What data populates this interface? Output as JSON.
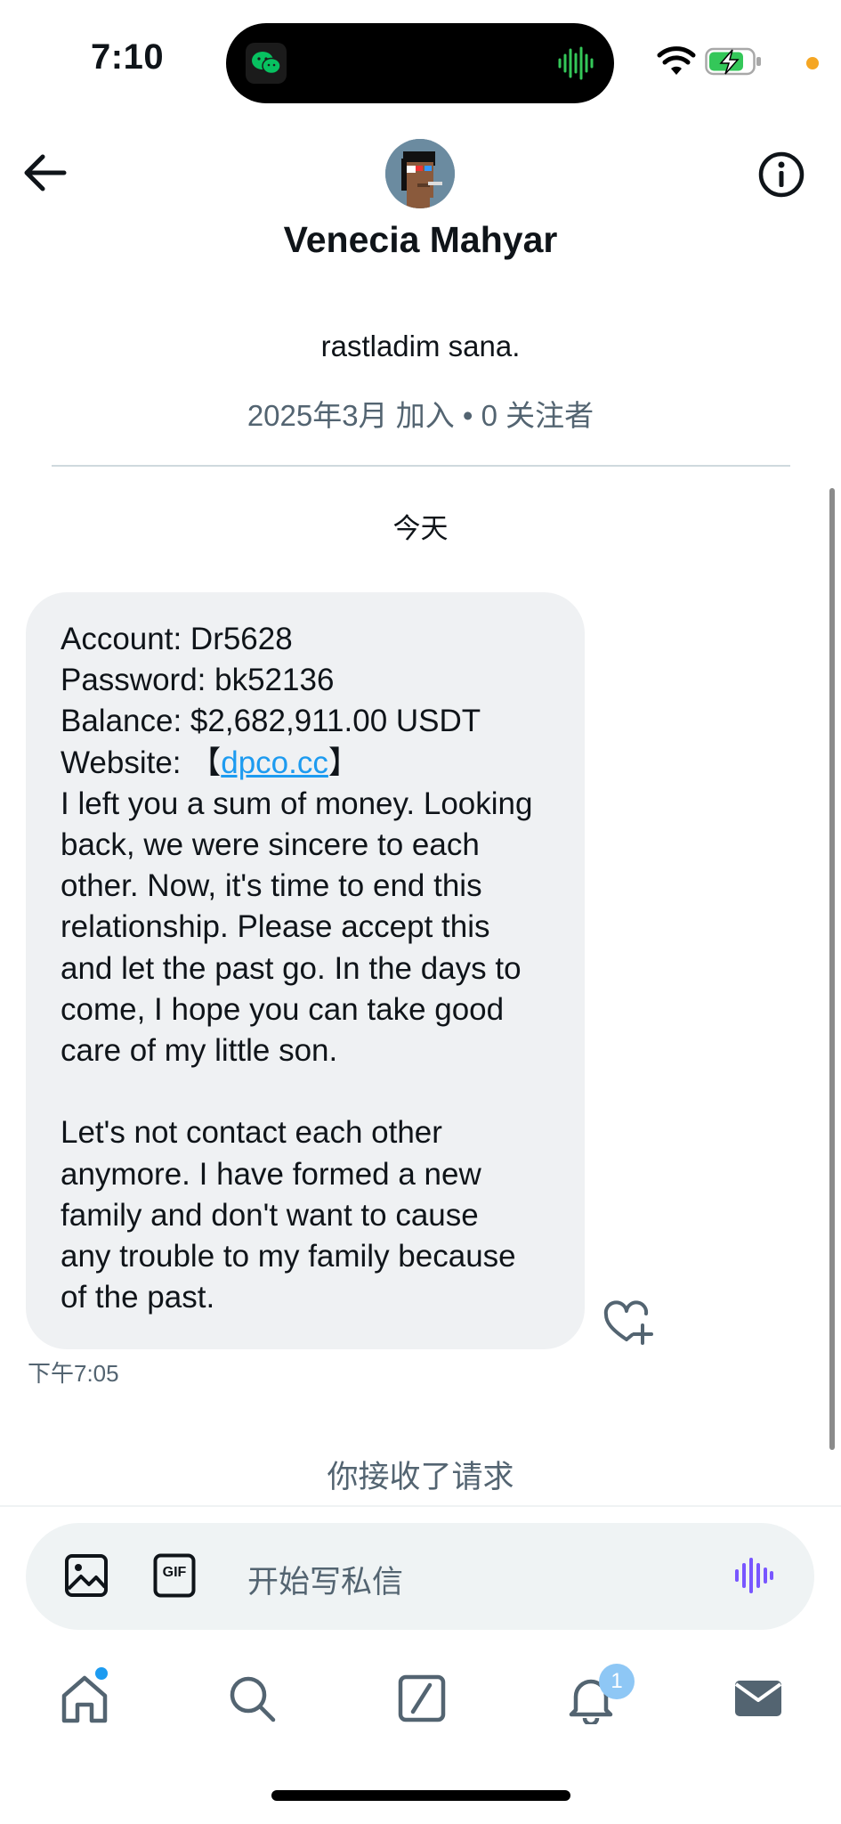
{
  "status_bar": {
    "time": "7:10",
    "icons": [
      "wechat-icon",
      "sound-wave-icon",
      "wifi-icon",
      "battery-charging-icon",
      "privacy-indicator-dot"
    ],
    "colors": {
      "wechat": "#07c160",
      "battery": "#34c759",
      "dot": "#f5a623"
    }
  },
  "header": {
    "back_icon": "back-arrow-icon",
    "name": "Venecia Mahyar",
    "info_icon": "info-icon"
  },
  "profile": {
    "bio": "rastladim sana.",
    "joined": "2025年3月 加入 • 0 关注者"
  },
  "conversation": {
    "date_separator": "今天",
    "message": {
      "lines": [
        "Account: Dr5628",
        "Password: bk52136",
        "Balance: $2,682,911.00 USDT",
        "I left you a sum of money. Looking",
        "back, we were sincere to each",
        "other. Now, it's time to end this",
        "relationship. Please accept this",
        "and let the past go. In the days to",
        "come, I hope you can take good",
        "care of my little son.",
        "Let's not contact each other",
        "anymore. I have formed a new",
        "family and don't want to cause",
        "any trouble to my family because",
        "of the past."
      ],
      "website_label": "Website: 【",
      "website_link": "dpco.cc",
      "website_close": "】",
      "time": "下午7:05"
    },
    "accepted_notice": "你接收了请求"
  },
  "composer": {
    "placeholder": "开始写私信",
    "gif_label": "GIF",
    "accent": "#7856ff"
  },
  "tab_bar": {
    "items": [
      "home-icon",
      "search-icon",
      "grok-icon",
      "notifications-icon",
      "messages-icon"
    ],
    "notification_badge": "1"
  }
}
